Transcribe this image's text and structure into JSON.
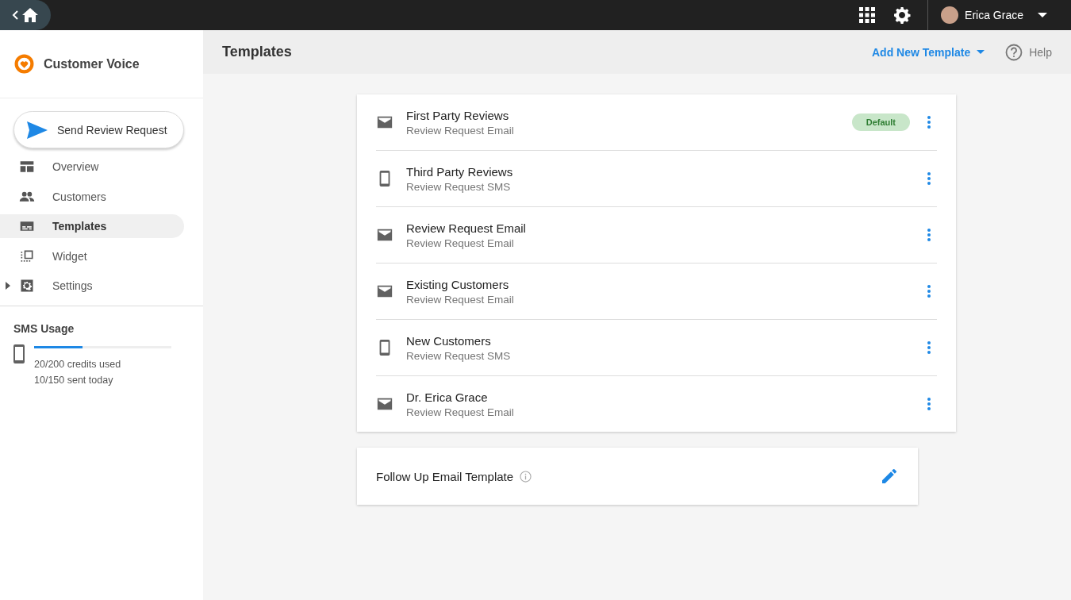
{
  "topbar": {
    "user_name": "Erica Grace"
  },
  "sidebar": {
    "app_name": "Customer Voice",
    "send_button": "Send Review Request",
    "items": [
      {
        "label": "Overview",
        "kind": "overview",
        "selected": false
      },
      {
        "label": "Customers",
        "kind": "customers",
        "selected": false
      },
      {
        "label": "Templates",
        "kind": "templates",
        "selected": true
      },
      {
        "label": "Widget",
        "kind": "widget",
        "selected": false
      },
      {
        "label": "Settings",
        "kind": "settings",
        "selected": false,
        "expanded": false
      }
    ],
    "sms_usage": {
      "title": "SMS Usage",
      "level": 0.35,
      "credits": "20/200 credits used",
      "sent": "10/150 sent today"
    }
  },
  "header": {
    "title": "Templates",
    "add_button": "Add New Template",
    "help": "Help"
  },
  "templates": [
    {
      "name": "First Party Reviews",
      "type": "Review Request Email",
      "kind": "email",
      "badge": "Default"
    },
    {
      "name": "Third Party Reviews",
      "type": "Review Request SMS",
      "kind": "sms"
    },
    {
      "name": "Review Request Email",
      "type": "Review Request Email",
      "kind": "email"
    },
    {
      "name": "Existing Customers",
      "type": "Review Request Email",
      "kind": "email"
    },
    {
      "name": "New Customers",
      "type": "Review Request SMS",
      "kind": "sms"
    },
    {
      "name": "Dr. Erica Grace",
      "type": "Review Request Email",
      "kind": "email"
    }
  ],
  "follow_up": {
    "title": "Follow Up Email Template"
  }
}
